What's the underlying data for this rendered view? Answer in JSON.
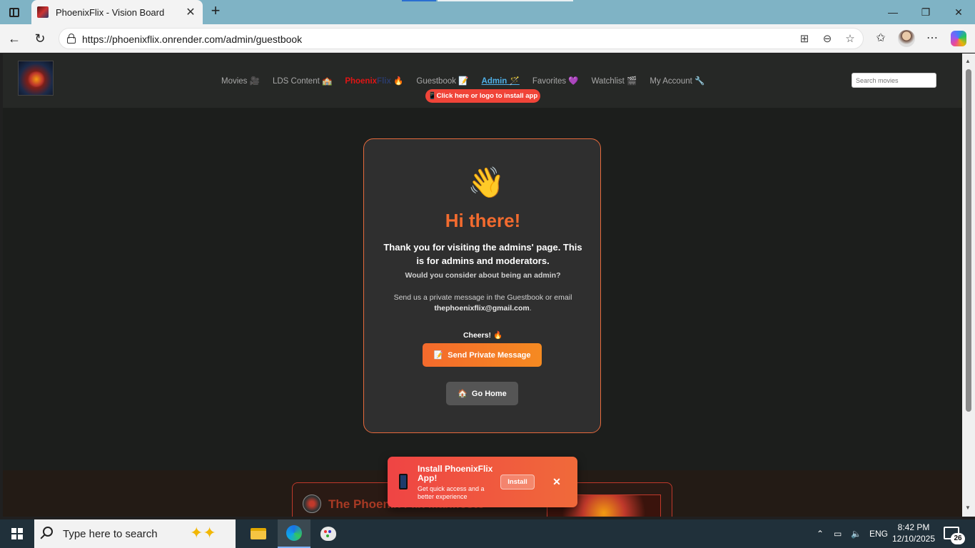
{
  "browser": {
    "tab_title": "PhoenixFlix - Vision Board",
    "tab_close": "✕",
    "new_tab": "+",
    "url": "https://phoenixflix.onrender.com/admin/guestbook",
    "win_min": "—",
    "win_restore": "❐",
    "win_close": "✕"
  },
  "site": {
    "nav": [
      {
        "label": "Movies 🎥"
      },
      {
        "label": "LDS Content 🏫"
      },
      {
        "label_main": "Phoenix",
        "label_flix": "Flix",
        "emoji": " 🔥"
      },
      {
        "label": "Guestbook 📝"
      },
      {
        "label": "Admin 🪄"
      },
      {
        "label": "Favorites 💜"
      },
      {
        "label": "Watchlist 🎬"
      },
      {
        "label": "My Account 🔧"
      }
    ],
    "install_pill": "📱Click here or logo to install app",
    "search_placeholder": "Search movies"
  },
  "card": {
    "emoji": "👋",
    "heading": "Hi there!",
    "lead": "Thank you for visiting the admins' page. This is for admins and moderators.",
    "question": "Would you consider about being an admin?",
    "send_text": "Send us a private message in the Guestbook or email",
    "email": "thephoenixflix@gmail.com",
    "send_end": ".",
    "cheers": "Cheers! 🔥",
    "send_button_icon": "📝",
    "send_button": "Send Private Message",
    "home_button_icon": "🏠",
    "home_button": "Go Home"
  },
  "feature": {
    "title": "The Phoenix Flix Manifesto"
  },
  "install_toast": {
    "title": "Install PhoenixFlix App!",
    "subtitle": "Get quick access and a better experience",
    "install_button": "Install",
    "close": "✕"
  },
  "taskbar": {
    "search_placeholder": "Type here to search",
    "language": "ENG",
    "time": "8:42 PM",
    "date": "12/10/2025",
    "notifications": "26"
  },
  "colors": {
    "accent_orange": "#f26b2f",
    "phoenix_red": "#e01515",
    "admin_blue": "#4fb0e8",
    "toast_red": "#ef4444"
  }
}
